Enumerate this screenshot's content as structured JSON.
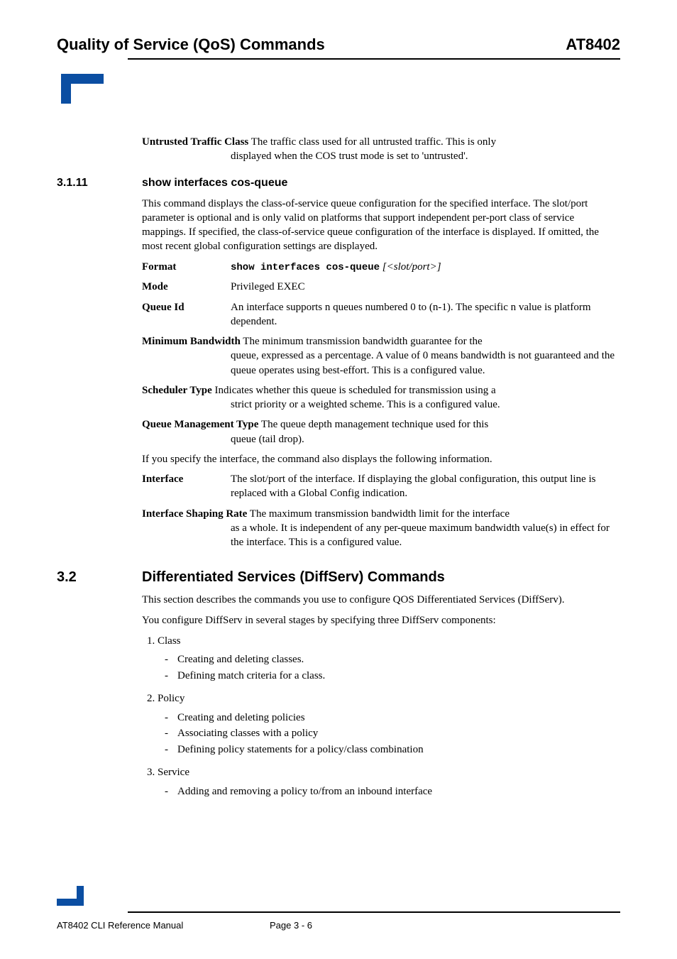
{
  "header": {
    "left": "Quality of Service (QoS) Commands",
    "right": "AT8402"
  },
  "untrusted": {
    "term": "Untrusted Traffic Class",
    "desc_inline": "  The traffic class used for all untrusted traffic. This is only",
    "desc_cont": "displayed when the COS trust mode is set to 'untrusted'."
  },
  "s311": {
    "num": "3.1.11",
    "title": "show interfaces cos-queue",
    "intro": "This command displays the class-of-service queue configuration for the specified interface. The slot/port parameter is optional and is only valid on platforms that support independent per-port class of service mappings. If specified, the class-of-service queue configuration of the interface is displayed. If omitted, the most recent global configuration settings are displayed.",
    "format_label": "Format",
    "format_cmd": "show interfaces cos-queue",
    "format_arg": " [<slot/port>]",
    "mode_label": "Mode",
    "mode_val": "Privileged EXEC",
    "queueid_label": "Queue Id",
    "queueid_val": "An interface supports n queues numbered 0 to (n-1). The specific n value is platform dependent.",
    "minbw_term": "Minimum Bandwidth",
    "minbw_inline": "  The minimum transmission bandwidth guarantee for the",
    "minbw_cont": "queue, expressed as a percentage. A value of 0 means bandwidth is not guaranteed and the queue operates using best-effort. This is a configured value.",
    "sched_term": "Scheduler Type",
    "sched_inline": "  Indicates whether this queue is scheduled for transmission using a",
    "sched_cont": "strict priority or a weighted scheme. This is a configured value.",
    "qmgmt_term": "Queue Management Type",
    "qmgmt_inline": "  The queue depth management technique used for this",
    "qmgmt_cont": "queue (tail drop).",
    "ifspec": "If you specify the interface, the command also displays the following information.",
    "iface_label": "Interface",
    "iface_val": "The slot/port of the interface. If displaying the global configuration, this output line is replaced with a Global Config indication.",
    "shaping_term": "Interface Shaping Rate",
    "shaping_inline": "  The maximum transmission bandwidth limit for the interface",
    "shaping_cont": "as a whole. It is independent of any per-queue maximum bandwidth value(s) in effect for the interface. This is a configured value."
  },
  "s32": {
    "num": "3.2",
    "title": "Differentiated Services (DiffServ) Commands",
    "p1": "This section describes the commands you use to configure QOS Differentiated Services (DiffServ).",
    "p2": "You configure DiffServ in several stages by specifying three DiffServ components:",
    "i1": "Class",
    "i1a": "Creating and deleting classes.",
    "i1b": "Defining match criteria for a class.",
    "i2": "Policy",
    "i2a": "Creating and deleting policies",
    "i2b": "Associating classes with a policy",
    "i2c": "Defining policy statements for a policy/class combination",
    "i3": "Service",
    "i3a": "Adding and removing a policy to/from an inbound interface"
  },
  "footer": {
    "left": "AT8402 CLI Reference Manual",
    "center": "Page 3 - 6"
  }
}
